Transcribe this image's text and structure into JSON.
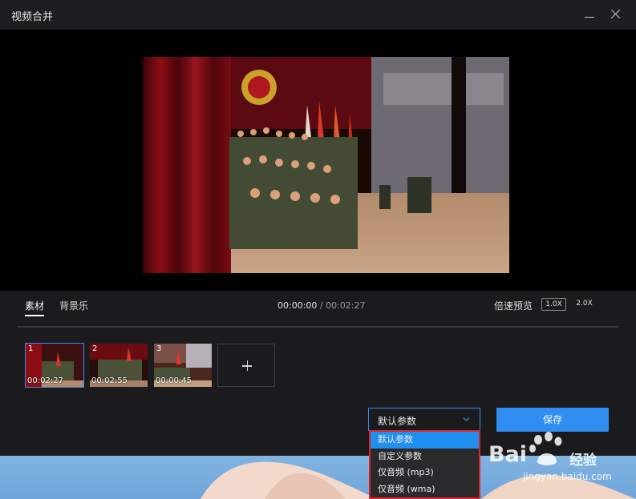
{
  "window": {
    "title": "视频合并"
  },
  "tabs": [
    {
      "label": "素材",
      "active": true
    },
    {
      "label": "背景乐",
      "active": false
    }
  ],
  "timecode": {
    "current": "00:00:00",
    "separator": " / ",
    "total": "00:02:27"
  },
  "speed": {
    "label": "倍速预览",
    "options": [
      "1.0X",
      "2.0X"
    ],
    "selected": "1.0X"
  },
  "clips": [
    {
      "index": "1",
      "duration": "00:02:27",
      "selected": true
    },
    {
      "index": "2",
      "duration": "00:02:55",
      "selected": false
    },
    {
      "index": "3",
      "duration": "00:00:45",
      "selected": false
    }
  ],
  "output": {
    "selected": "默认参数",
    "options": [
      "默认参数",
      "自定义参数",
      "仅音频 (mp3)",
      "仅音频 (wma)"
    ],
    "save_label": "保存"
  },
  "watermark": {
    "brand": "Bai",
    "brand_suffix": "经验",
    "url": "jingyan.baidu.com"
  },
  "colors": {
    "accent": "#2f8ef0",
    "highlight_border": "#e0232a",
    "background": "#1b1b1d"
  }
}
